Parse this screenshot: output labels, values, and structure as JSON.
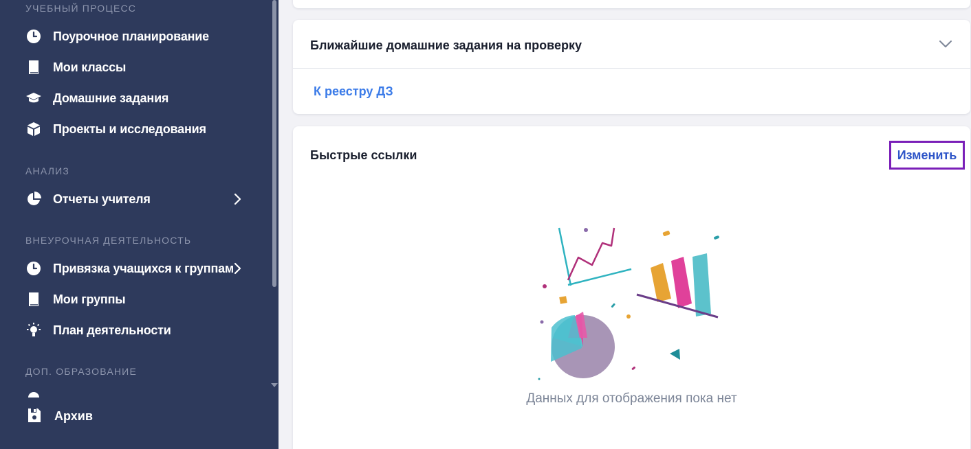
{
  "sidebar": {
    "sections": [
      {
        "title": "УЧЕБНЫЙ ПРОЦЕСС",
        "items": [
          {
            "label": "Поурочное планирование",
            "icon": "clock-icon"
          },
          {
            "label": "Мои классы",
            "icon": "book-icon"
          },
          {
            "label": "Домашние задания",
            "icon": "graduation-cap-icon"
          },
          {
            "label": "Проекты и исследования",
            "icon": "cube-icon"
          }
        ]
      },
      {
        "title": "АНАЛИЗ",
        "items": [
          {
            "label": "Отчеты учителя",
            "icon": "pie-chart-icon",
            "has_submenu": true
          }
        ]
      },
      {
        "title": "ВНЕУРОЧНАЯ ДЕЯТЕЛЬНОСТЬ",
        "items": [
          {
            "label": "Привязка учащихся к группам",
            "icon": "clock-icon",
            "has_submenu": true
          },
          {
            "label": "Мои группы",
            "icon": "book-icon"
          },
          {
            "label": "План деятельности",
            "icon": "lightbulb-icon"
          }
        ]
      },
      {
        "title": "ДОП. ОБРАЗОВАНИЕ",
        "items": []
      }
    ],
    "archive_label": "Архив"
  },
  "main": {
    "homework_card": {
      "title": "Ближайшие домашние задания на проверку",
      "link_label": "К реестру ДЗ"
    },
    "quick_links_card": {
      "title": "Быстрые ссылки",
      "edit_label": "Изменить",
      "empty_message": "Данных для отображения пока нет"
    }
  },
  "colors": {
    "sidebar_bg": "#2e3a5c",
    "link": "#3b7be8",
    "highlight_border": "#7a1fb8"
  }
}
